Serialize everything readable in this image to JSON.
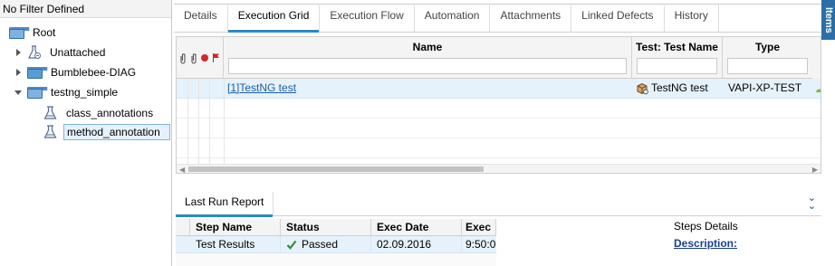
{
  "tree": {
    "filter_label": "No Filter Defined",
    "items": [
      {
        "label": "Root",
        "icon": "folder-open-icon"
      },
      {
        "label": "Unattached",
        "icon": "unattached-icon"
      },
      {
        "label": "Bumblebee-DIAG",
        "icon": "folder-icon"
      },
      {
        "label": "testng_simple",
        "icon": "folder-open-icon"
      },
      {
        "label": "class_annotations",
        "icon": "test-set-icon"
      },
      {
        "label": "method_annotation",
        "icon": "test-set-icon",
        "selected": true
      }
    ]
  },
  "tabs": [
    {
      "label": "Details"
    },
    {
      "label": "Execution Grid",
      "active": true
    },
    {
      "label": "Execution Flow"
    },
    {
      "label": "Automation"
    },
    {
      "label": "Attachments"
    },
    {
      "label": "Linked Defects"
    },
    {
      "label": "History"
    }
  ],
  "side_tab": "Items",
  "grid": {
    "columns": {
      "name": "Name",
      "test_name": "Test: Test Name",
      "type": "Type"
    },
    "rows": [
      {
        "name": "[1]TestNG test",
        "test_name": "TestNG test",
        "type": "VAPI-XP-TEST"
      }
    ]
  },
  "bottom": {
    "tab_label": "Last Run Report",
    "expand_icon": "double-chevron-down-icon",
    "report": {
      "columns": [
        "Step Name",
        "Status",
        "Exec Date",
        "Exec"
      ],
      "rows": [
        {
          "step_name": "Test Results",
          "status": "Passed",
          "exec_date": "02.09.2016",
          "exec_time": "9:50:0"
        }
      ]
    },
    "steps_details": {
      "title": "Steps Details",
      "description_label": "Description:"
    }
  },
  "colors": {
    "accent": "#2a8bc3",
    "selection": "#e6f2fb",
    "folder": "#5b9bd5",
    "link": "#1a5ea8",
    "passed": "#2e8b3a"
  }
}
